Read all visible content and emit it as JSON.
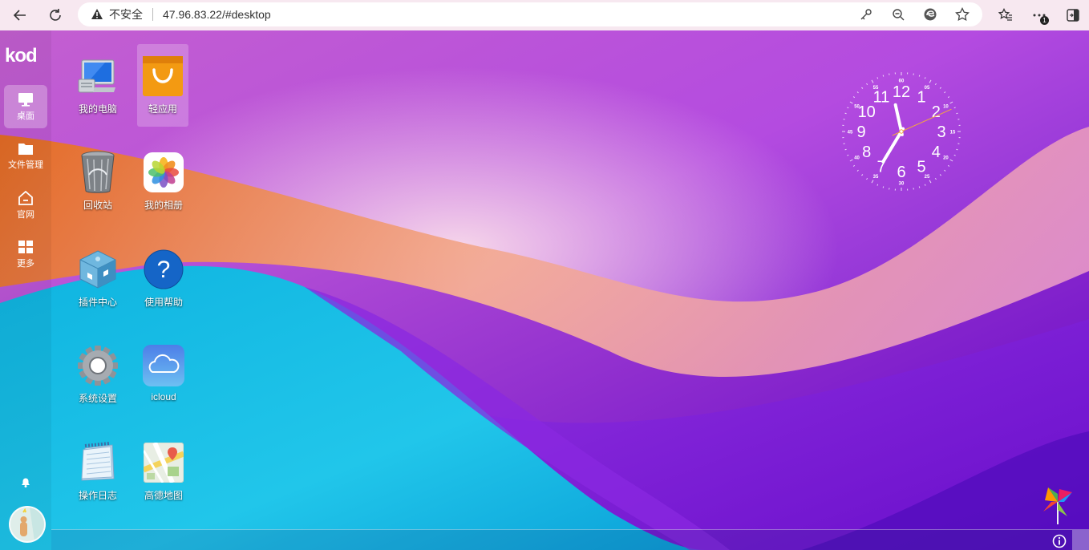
{
  "browser": {
    "security_label": "不安全",
    "url": "47.96.83.22/#desktop",
    "notification_count": "1"
  },
  "sidebar": {
    "logo": "kod",
    "items": [
      {
        "label": "桌面",
        "icon": "monitor-icon",
        "active": true
      },
      {
        "label": "文件管理",
        "icon": "folder-icon",
        "active": false
      },
      {
        "label": "官网",
        "icon": "home-icon",
        "active": false
      },
      {
        "label": "更多",
        "icon": "grid-icon",
        "active": false
      }
    ]
  },
  "desktop_icons": [
    {
      "label": "我的电脑",
      "icon": "computer-icon"
    },
    {
      "label": "轻应用",
      "icon": "shopping-bag-icon"
    },
    {
      "label": "回收站",
      "icon": "recycle-bin-icon"
    },
    {
      "label": "我的相册",
      "icon": "photos-icon"
    },
    {
      "label": "插件中心",
      "icon": "plugin-cube-icon"
    },
    {
      "label": "使用帮助",
      "icon": "help-icon"
    },
    {
      "label": "系统设置",
      "icon": "settings-gear-icon"
    },
    {
      "label": "icloud",
      "icon": "cloud-icon"
    },
    {
      "label": "操作日志",
      "icon": "notepad-icon"
    },
    {
      "label": "高德地图",
      "icon": "map-icon"
    }
  ],
  "clock": {
    "hour_numbers": [
      "12",
      "1",
      "2",
      "3",
      "4",
      "5",
      "6",
      "7",
      "8",
      "9",
      "10",
      "11"
    ],
    "minute_numbers": [
      "60",
      "05",
      "10",
      "15",
      "20",
      "25",
      "30",
      "35",
      "40",
      "45",
      "50",
      "55"
    ],
    "hour": 11,
    "minute": 35,
    "second": 11
  }
}
